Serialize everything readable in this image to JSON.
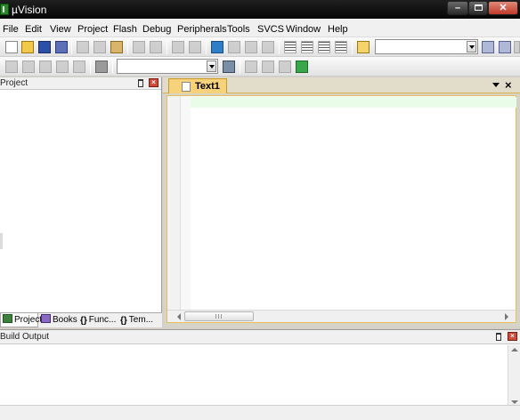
{
  "window": {
    "title": "µVision"
  },
  "menu": [
    "File",
    "Edit",
    "View",
    "Project",
    "Flash",
    "Debug",
    "Peripherals",
    "Tools",
    "SVCS",
    "Window",
    "Help"
  ],
  "icons": {
    "toolbar1": [
      "new-file-icon",
      "open-file-icon",
      "save-icon",
      "save-all-icon",
      "cut-icon",
      "copy-icon",
      "paste-icon",
      "undo-icon",
      "redo-icon",
      "navigate-back-icon",
      "navigate-forward-icon",
      "insert-bookmark-icon",
      "previous-bookmark-icon",
      "next-bookmark-icon",
      "clear-bookmarks-icon",
      "indent-icon",
      "unindent-icon",
      "comment-icon",
      "uncomment-icon",
      "find-in-files-icon",
      "find-icon",
      "debug-session-icon",
      "configuration-icon"
    ],
    "toolbar2": [
      "translate-icon",
      "build-icon",
      "rebuild-icon",
      "batch-build-icon",
      "stop-build-icon",
      "download-icon",
      "target-options-icon",
      "manage-components-icon",
      "file-extensions-icon",
      "pack-installer-icon",
      "select-packs-icon"
    ]
  },
  "project_pane": {
    "title": "Project",
    "tabs": [
      {
        "label": "Project"
      },
      {
        "label": "Books"
      },
      {
        "label": "Func..."
      },
      {
        "label": "Tem..."
      }
    ]
  },
  "editor": {
    "tab_label": "Text1",
    "close_label": "×"
  },
  "build_output": {
    "title": "Build Output"
  }
}
